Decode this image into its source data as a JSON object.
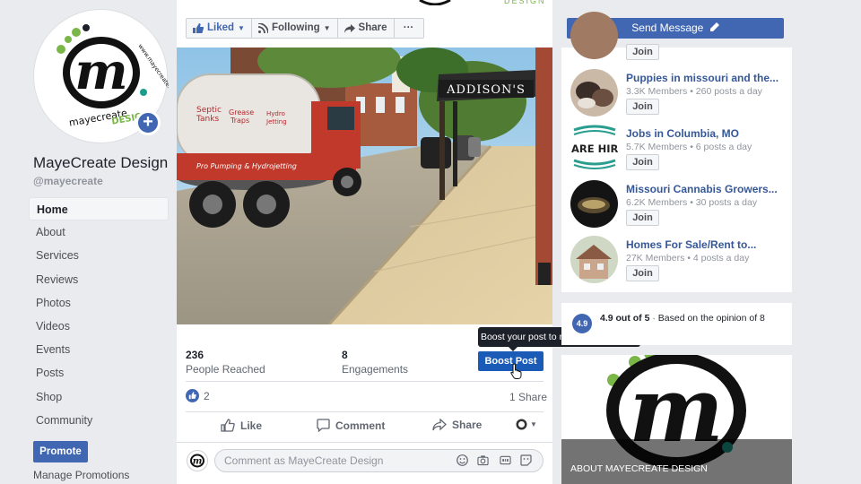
{
  "page": {
    "name": "MayeCreate Design",
    "handle": "@mayecreate",
    "logo_letter": "m",
    "logo_ring_text": "www.mayecreate.com",
    "logo_word1": "mayecreate",
    "logo_word2": "DESIGN"
  },
  "sidebar": {
    "items": [
      {
        "label": "Home",
        "active": true
      },
      {
        "label": "About"
      },
      {
        "label": "Services"
      },
      {
        "label": "Reviews"
      },
      {
        "label": "Photos"
      },
      {
        "label": "Videos"
      },
      {
        "label": "Events"
      },
      {
        "label": "Posts"
      },
      {
        "label": "Shop"
      },
      {
        "label": "Community"
      }
    ],
    "promote_label": "Promote",
    "manage_label": "Manage Promotions"
  },
  "actions": {
    "liked": "Liked",
    "following": "Following",
    "share": "Share",
    "more": "···",
    "send_message": "Send Message"
  },
  "post": {
    "photo_sign": "ADDISON'S",
    "truck_text_1": "Septic",
    "truck_text_2": "Tanks",
    "truck_text_3": "Grease",
    "truck_text_4": "Traps",
    "truck_text_5": "Hydro",
    "truck_text_6": "Jetting",
    "truck_text_7": "Pro Pumping & Hydrojetting",
    "reached_value": "236",
    "reached_label": "People Reached",
    "engagements_value": "8",
    "engagements_label": "Engagements",
    "boost_tooltip": "Boost your post to reach more people",
    "boost_label": "Boost Post",
    "likes_count": "2",
    "shares": "1 Share",
    "like_label": "Like",
    "comment_label": "Comment",
    "share_label": "Share",
    "comment_placeholder": "Comment as MayeCreate Design"
  },
  "groups": [
    {
      "name": "",
      "meta": "",
      "join": "Join"
    },
    {
      "name": "Puppies in missouri and the...",
      "meta": "3.3K Members • 260 posts a day",
      "join": "Join"
    },
    {
      "name": "Jobs in Columbia, MO",
      "meta": "5.7K Members • 6 posts a day",
      "join": "Join",
      "thumb_text": "ARE HIRI"
    },
    {
      "name": "Missouri Cannabis Growers...",
      "meta": "6.2K Members • 30 posts a day",
      "join": "Join"
    },
    {
      "name": "Homes For Sale/Rent to...",
      "meta": "27K Members • 4 posts a day",
      "join": "Join"
    }
  ],
  "rating": {
    "badge": "4.9",
    "score": "4.9 out of 5",
    "sep": "·",
    "basis": "Based on the opinion of 8"
  },
  "about": {
    "label": "ABOUT MAYECREATE DESIGN"
  },
  "colors": {
    "fb_blue": "#4267b2",
    "boost_blue": "#1a5bb8",
    "link_blue": "#365899",
    "logo_green": "#7ab648",
    "logo_teal": "#1a9c8a",
    "bg": "#e9ebee"
  },
  "icons": [
    "thumbs-up-icon",
    "rss-icon",
    "share-arrow-icon",
    "pencil-icon",
    "plus-icon",
    "comment-icon",
    "smiley-icon",
    "camera-icon",
    "gif-icon",
    "sticker-icon",
    "globe-icon"
  ]
}
